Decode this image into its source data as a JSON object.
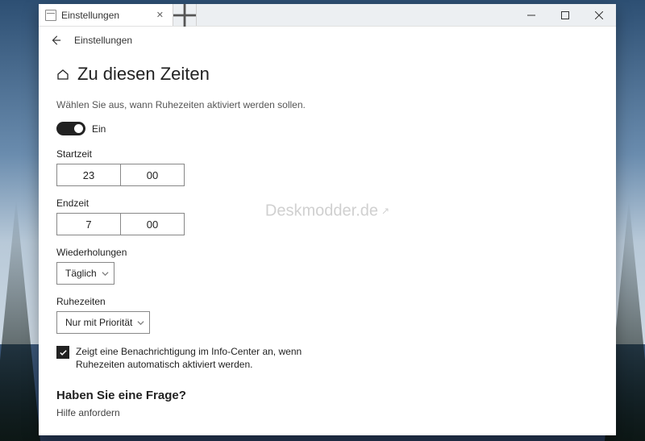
{
  "tab": {
    "title": "Einstellungen"
  },
  "breadcrumb": "Einstellungen",
  "page": {
    "title": "Zu diesen Zeiten",
    "subtitle": "Wählen Sie aus, wann Ruhezeiten aktiviert werden sollen.",
    "toggle_label": "Ein",
    "toggle_on": true,
    "start_label": "Startzeit",
    "start_hour": "23",
    "start_min": "00",
    "end_label": "Endzeit",
    "end_hour": "7",
    "end_min": "00",
    "repeat_label": "Wiederholungen",
    "repeat_value": "Täglich",
    "quiet_label": "Ruhezeiten",
    "quiet_value": "Nur mit Priorität",
    "checkbox_checked": true,
    "checkbox_text": "Zeigt eine Benachrichtigung im Info-Center an, wenn Ruhezeiten automatisch aktiviert werden.",
    "footer_question": "Haben Sie eine Frage?",
    "footer_link": "Hilfe anfordern"
  },
  "watermark": "Deskmodder.de"
}
